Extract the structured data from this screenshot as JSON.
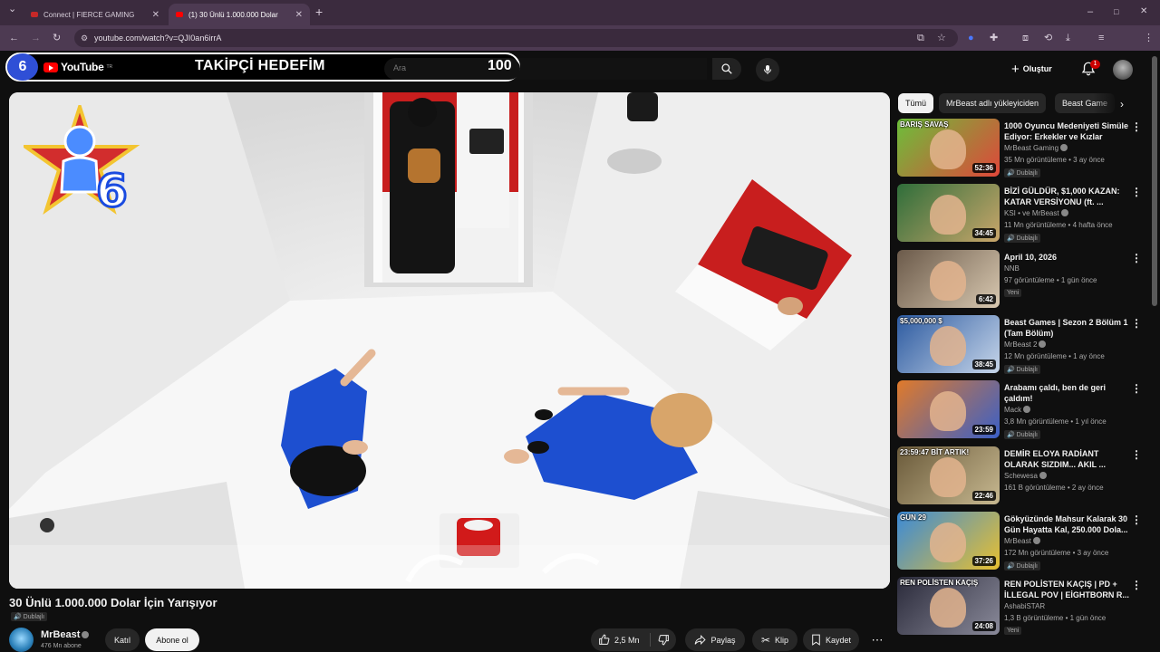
{
  "browser": {
    "tabs": [
      {
        "title": "Connect | FIERCE GAMING",
        "active": false
      },
      {
        "title": "(1) 30 Ünlü 1.000.000 Dolar",
        "active": true
      }
    ],
    "url": "youtube.com/watch?v=QJI0an6irrA",
    "profile_initial": "A"
  },
  "overlay": {
    "channel_number": "6",
    "title": "TAKİPÇİ HEDEFİM",
    "count": "100",
    "logo_text": "YouTube",
    "logo_suffix": "TR"
  },
  "header": {
    "search_placeholder": "Ara",
    "create_label": "Oluştur",
    "notification_count": "1"
  },
  "video": {
    "title": "30 Ünlü 1.000.000 Dolar İçin Yarışıyor",
    "dub_badge": "Dublajlı",
    "channel": "MrBeast",
    "subscribers": "476 Mn abone",
    "join_label": "Katıl",
    "subscribe_label": "Abone ol",
    "likes": "2,5 Mn",
    "share_label": "Paylaş",
    "clip_label": "Klip",
    "save_label": "Kaydet",
    "watermark_number": "6"
  },
  "sidebar": {
    "chips": [
      "Tümü",
      "MrBeast adlı yükleyiciden",
      "Beast Game"
    ],
    "recommendations": [
      {
        "title": "1000 Oyuncu Medeniyeti Simüle Ediyor: Erkekler ve Kızlar",
        "channel": "MrBeast Gaming",
        "verified": true,
        "meta": "35 Mn görüntüleme • 3 ay önce",
        "badge": "Dublajlı",
        "duration": "52:36",
        "thumb_text": "BARIŞ  SAVAŞ",
        "colors": [
          "#6bbf3a",
          "#e0463a"
        ]
      },
      {
        "title": "BİZİ GÜLDÜR, $1,000 KAZAN: KATAR VERSİYONU (ft. ...",
        "channel": "KSI • ve MrBeast",
        "verified": true,
        "meta": "11 Mn görüntüleme • 4 hafta önce",
        "badge": "Dublajlı",
        "duration": "34:45",
        "thumb_text": "",
        "colors": [
          "#2f6e3a",
          "#c9a66b"
        ]
      },
      {
        "title": "April 10, 2026",
        "channel": "NNB",
        "verified": false,
        "meta": "97 görüntüleme • 1 gün önce",
        "badge": "Yeni",
        "duration": "6:42",
        "thumb_text": "",
        "colors": [
          "#6b5a4a",
          "#d8c8b0"
        ]
      },
      {
        "title": "Beast Games | Sezon 2 Bölüm 1 (Tam Bölüm)",
        "channel": "MrBeast 2",
        "verified": true,
        "meta": "12 Mn görüntüleme • 1 ay önce",
        "badge": "Dublajlı",
        "duration": "38:45",
        "thumb_text": "$5,000,000 $",
        "colors": [
          "#2c5aa0",
          "#c7d6ea"
        ]
      },
      {
        "title": "Arabamı çaldı, ben de geri çaldım!",
        "channel": "Mack",
        "verified": true,
        "meta": "3,8 Mn görüntüleme • 1 yıl önce",
        "badge": "Dublajlı",
        "duration": "23:59",
        "thumb_text": "",
        "colors": [
          "#e07a2a",
          "#3a60c8"
        ]
      },
      {
        "title": "DEMİR ELOYA RADİANT OLARAK SIZDIM... AKIL ...",
        "channel": "Schewesa",
        "verified": true,
        "meta": "161 B görüntüleme • 2 ay önce",
        "badge": "",
        "duration": "22:46",
        "thumb_text": "23:59:47  BİT ARTIK!",
        "colors": [
          "#6a5a3a",
          "#c7b890"
        ]
      },
      {
        "title": "Gökyüzünde Mahsur Kalarak 30 Gün Hayatta Kal, 250.000 Dola...",
        "channel": "MrBeast",
        "verified": true,
        "meta": "172 Mn görüntüleme • 3 ay önce",
        "badge": "Dublajlı",
        "duration": "37:26",
        "thumb_text": "GÜN 29",
        "colors": [
          "#3a8ad8",
          "#e8c030"
        ]
      },
      {
        "title": "REN POLİSTEN KAÇIŞ | PD + İLLEGAL POV | EİGHTBORN R...",
        "channel": "AshabiSTAR",
        "verified": false,
        "meta": "1,3 B görüntüleme • 1 gün önce",
        "badge": "Yeni",
        "duration": "24:08",
        "thumb_text": "REN POLİSTEN KAÇIŞ",
        "colors": [
          "#2a2a3a",
          "#8a8a9a"
        ]
      }
    ]
  }
}
